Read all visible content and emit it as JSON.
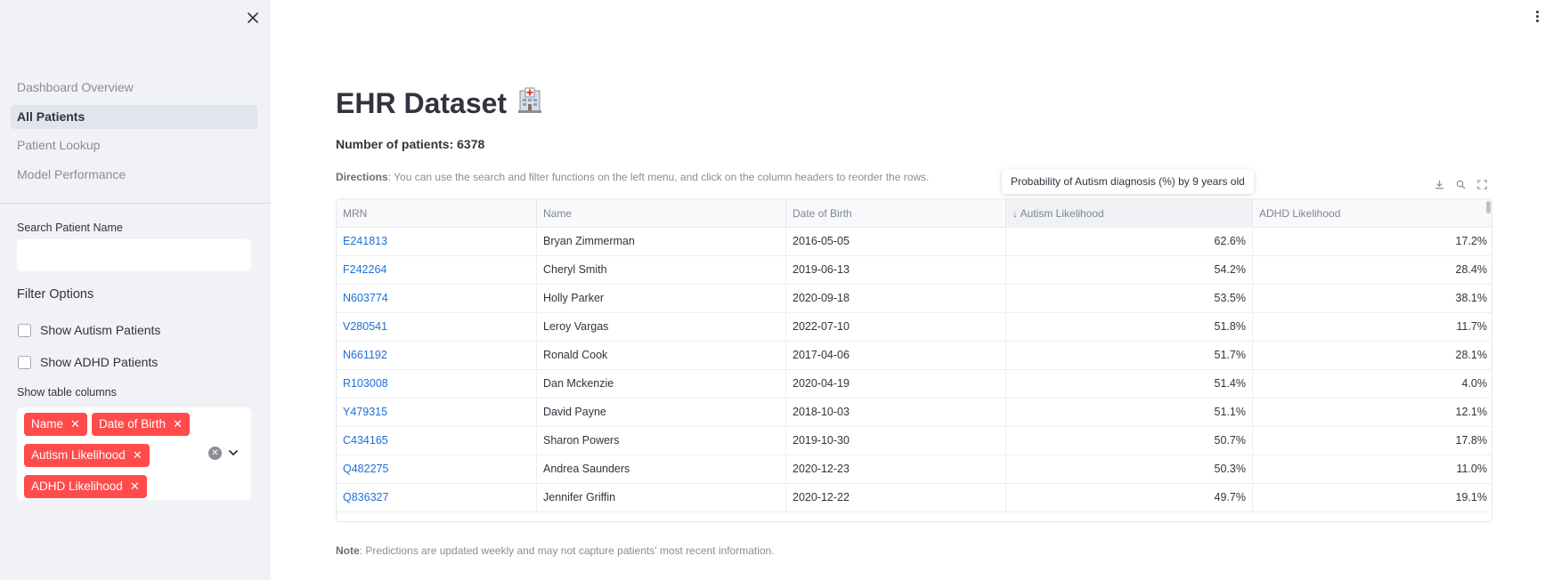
{
  "sidebar": {
    "nav": [
      {
        "label": "Dashboard Overview",
        "active": false
      },
      {
        "label": "All Patients",
        "active": true
      },
      {
        "label": "Patient Lookup",
        "active": false
      },
      {
        "label": "Model Performance",
        "active": false
      }
    ],
    "search": {
      "label": "Search Patient Name",
      "value": "",
      "placeholder": ""
    },
    "filter": {
      "title": "Filter Options",
      "autism_label": "Show Autism Patients",
      "adhd_label": "Show ADHD Patients"
    },
    "columns": {
      "label": "Show table columns",
      "tags": [
        "Name",
        "Date of Birth",
        "Autism Likelihood",
        "ADHD Likelihood"
      ]
    }
  },
  "main": {
    "title": "EHR Dataset",
    "title_emoji": "hospital-icon",
    "count_text": "Number of patients: 6378",
    "directions_label": "Directions",
    "directions_text": ": You can use the search and filter functions on the left menu, and click on the column headers to reorder the rows.",
    "tooltip": "Probability of Autism diagnosis (%) by 9 years old",
    "note_label": "Note",
    "note_text": ": Predictions are updated weekly and may not capture patients' most recent information."
  },
  "table": {
    "headers": [
      "MRN",
      "Name",
      "Date of Birth",
      "↓ Autism Likelihood",
      "ADHD Likelihood"
    ],
    "rows": [
      [
        "E241813",
        "Bryan Zimmerman",
        "2016-05-05",
        "62.6%",
        "17.2%"
      ],
      [
        "F242264",
        "Cheryl Smith",
        "2019-06-13",
        "54.2%",
        "28.4%"
      ],
      [
        "N603774",
        "Holly Parker",
        "2020-09-18",
        "53.5%",
        "38.1%"
      ],
      [
        "V280541",
        "Leroy Vargas",
        "2022-07-10",
        "51.8%",
        "11.7%"
      ],
      [
        "N661192",
        "Ronald Cook",
        "2017-04-06",
        "51.7%",
        "28.1%"
      ],
      [
        "R103008",
        "Dan Mckenzie",
        "2020-04-19",
        "51.4%",
        "4.0%"
      ],
      [
        "Y479315",
        "David Payne",
        "2018-10-03",
        "51.1%",
        "12.1%"
      ],
      [
        "C434165",
        "Sharon Powers",
        "2019-10-30",
        "50.7%",
        "17.8%"
      ],
      [
        "Q482275",
        "Andrea Saunders",
        "2020-12-23",
        "50.3%",
        "11.0%"
      ],
      [
        "Q836327",
        "Jennifer Griffin",
        "2020-12-22",
        "49.7%",
        "19.1%"
      ]
    ]
  },
  "colors": {
    "accent": "#ff4b4b",
    "link": "#1f6ed4",
    "sidebar_bg": "#f0f2f6"
  }
}
